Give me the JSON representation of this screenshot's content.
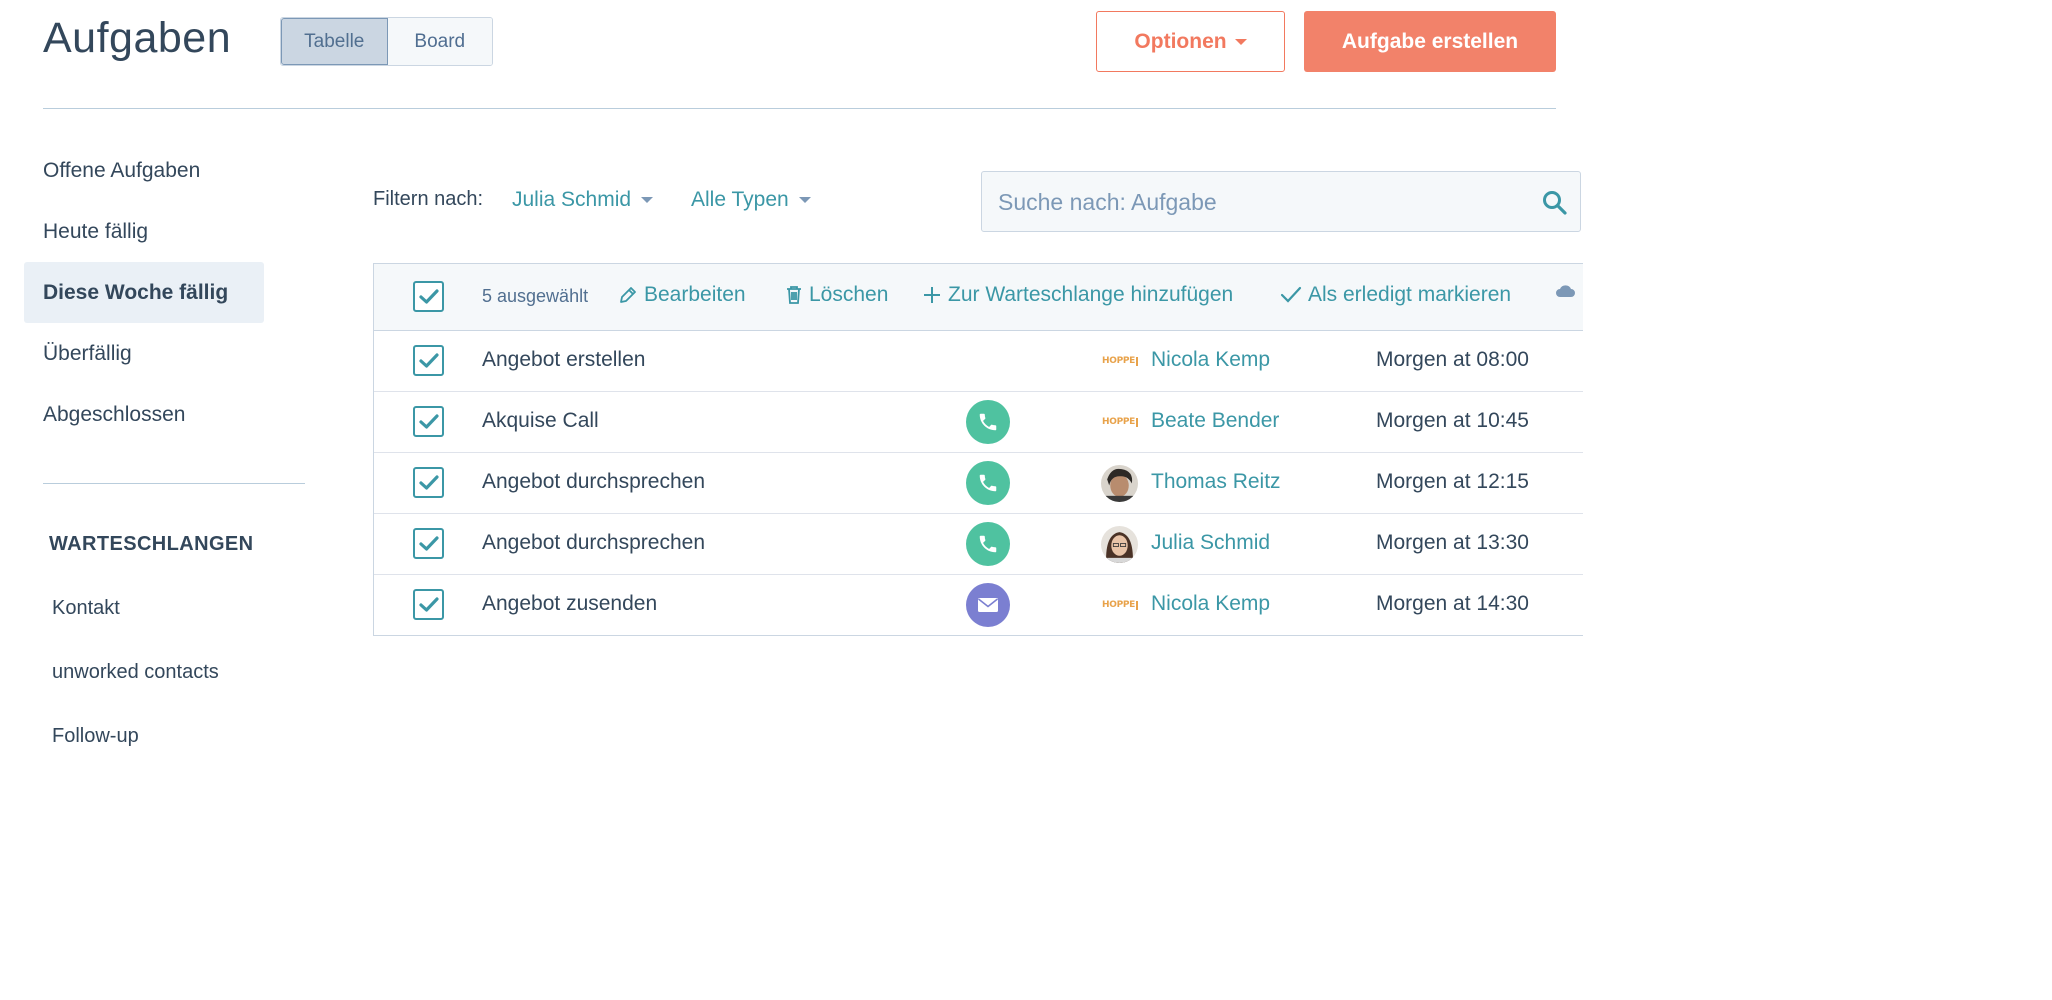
{
  "header": {
    "title": "Aufgaben",
    "view_tabs": [
      {
        "label": "Tabelle",
        "active": true
      },
      {
        "label": "Board",
        "active": false
      }
    ],
    "options_label": "Optionen",
    "create_label": "Aufgabe erstellen"
  },
  "sidebar": {
    "items": [
      {
        "label": "Offene Aufgaben",
        "active": false
      },
      {
        "label": "Heute fällig",
        "active": false
      },
      {
        "label": "Diese Woche fällig",
        "active": true
      },
      {
        "label": "Überfällig",
        "active": false
      },
      {
        "label": "Abgeschlossen",
        "active": false
      }
    ],
    "queues_heading": "WARTESCHLANGEN",
    "queues": [
      "Kontakt",
      "unworked contacts",
      "Follow-up"
    ]
  },
  "filters": {
    "label": "Filtern nach:",
    "owner": "Julia Schmid",
    "type": "Alle Typen"
  },
  "search": {
    "placeholder": "Suche nach: Aufgabe",
    "value": ""
  },
  "bulk": {
    "count_label": "5 ausgewählt",
    "edit": "Bearbeiten",
    "delete": "Löschen",
    "add_queue": "Zur Warteschlange hinzufügen",
    "mark_done": "Als erledigt markieren"
  },
  "tasks": [
    {
      "title": "Angebot erstellen",
      "type": "none",
      "owner": "Nicola Kemp",
      "owner_avatar": "hoppe-logo",
      "due": "Morgen at 08:00"
    },
    {
      "title": "Akquise Call",
      "type": "call",
      "owner": "Beate Bender",
      "owner_avatar": "hoppe-logo",
      "due": "Morgen at 10:45"
    },
    {
      "title": "Angebot durchsprechen",
      "type": "call",
      "owner": "Thomas Reitz",
      "owner_avatar": "photo",
      "due": "Morgen at 12:15"
    },
    {
      "title": "Angebot durchsprechen",
      "type": "call",
      "owner": "Julia Schmid",
      "owner_avatar": "photo",
      "due": "Morgen at 13:30"
    },
    {
      "title": "Angebot zusenden",
      "type": "email",
      "owner": "Nicola Kemp",
      "owner_avatar": "hoppe-logo",
      "due": "Morgen at 14:30"
    }
  ],
  "logo_text": "HOPPE",
  "colors": {
    "accent": "#f2795f",
    "link": "#3b97a6",
    "call": "#4fc2a0",
    "email": "#7b7fd1"
  }
}
